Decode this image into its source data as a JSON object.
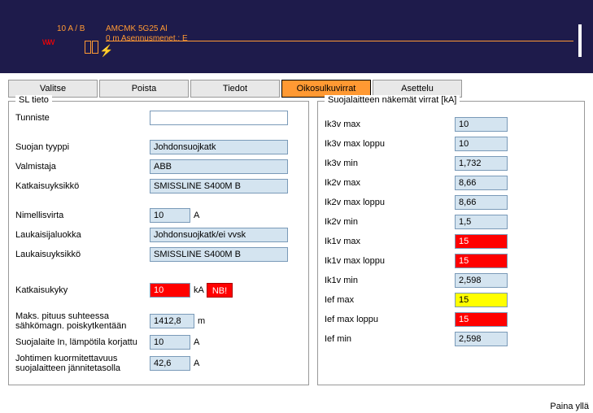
{
  "diagram": {
    "rating": "10 A / B",
    "cable": "AMCMK 5G25 Al",
    "install": "0 m   Asennusmenet.: E"
  },
  "tabs": {
    "valitse": "Valitse",
    "poista": "Poista",
    "tiedot": "Tiedot",
    "oikosulkuvirrat": "Oikosulkuvirrat",
    "asettelu": "Asettelu"
  },
  "left": {
    "title": "SL tieto",
    "tunniste_label": "Tunniste",
    "tunniste_value": "",
    "suojan_tyyppi_label": "Suojan tyyppi",
    "suojan_tyyppi_value": "Johdonsuojkatk",
    "valmistaja_label": "Valmistaja",
    "valmistaja_value": "ABB",
    "katkaisuyksikko_label": "Katkaisuyksikkö",
    "katkaisuyksikko_value": "SMISSLINE S400M B",
    "nimellisvirta_label": "Nimellisvirta",
    "nimellisvirta_value": "10",
    "nimellisvirta_unit": "A",
    "laukaisijaluokka_label": "Laukaisijaluokka",
    "laukaisijaluokka_value": "Johdonsuojkatk/ei vvsk",
    "laukaisuyksikko_label": "Laukaisuyksikkö",
    "laukaisuyksikko_value": "SMISSLINE S400M B",
    "katkaisukyky_label": "Katkaisukyky",
    "katkaisukyky_value": "10",
    "katkaisukyky_unit": "kA",
    "nb_label": "NB!",
    "maks_pituus_label": "Maks. pituus suhteessa sähkömagn. poiskytkentään",
    "maks_pituus_value": "1412,8",
    "maks_pituus_unit": "m",
    "suojalaite_in_label": "Suojalaite In, lämpötila korjattu",
    "suojalaite_in_value": "10",
    "suojalaite_in_unit": "A",
    "johtimen_label": "Johtimen kuormitettavuus suojalaitteen jännitetasolla",
    "johtimen_value": "42,6",
    "johtimen_unit": "A"
  },
  "right": {
    "title": "Suojalaitteen näkemät virrat [kA]",
    "rows": [
      {
        "label": "Ik3v max",
        "value": "10",
        "cls": ""
      },
      {
        "label": "Ik3v max loppu",
        "value": "10",
        "cls": ""
      },
      {
        "label": "Ik3v min",
        "value": "1,732",
        "cls": ""
      },
      {
        "label": "Ik2v max",
        "value": "8,66",
        "cls": ""
      },
      {
        "label": "Ik2v max loppu",
        "value": "8,66",
        "cls": ""
      },
      {
        "label": "Ik2v min",
        "value": "1,5",
        "cls": ""
      },
      {
        "label": "Ik1v max",
        "value": "15",
        "cls": "red"
      },
      {
        "label": "Ik1v max loppu",
        "value": "15",
        "cls": "red"
      },
      {
        "label": "Ik1v min",
        "value": "2,598",
        "cls": ""
      },
      {
        "label": "Ief max",
        "value": "15",
        "cls": "yellow"
      },
      {
        "label": "Ief max loppu",
        "value": "15",
        "cls": "red"
      },
      {
        "label": "Ief min",
        "value": "2,598",
        "cls": ""
      }
    ]
  },
  "footer": "Paina yllä"
}
